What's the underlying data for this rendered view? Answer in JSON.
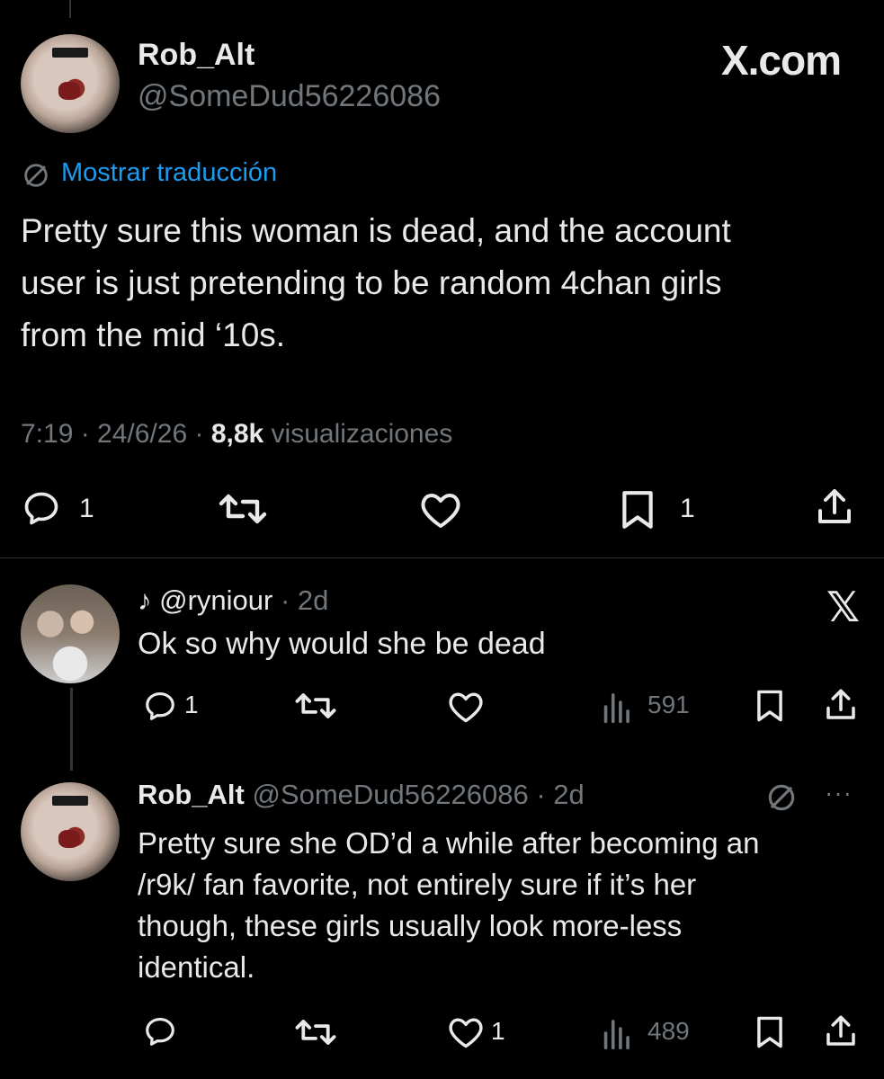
{
  "main_tweet": {
    "author_name": "Rob_Alt",
    "author_handle": "@SomeDud56226086",
    "watermark": "X.com",
    "translate_label": "Mostrar traducción",
    "text_lines": [
      "Pretty sure this woman is dead, and the account",
      "user is just pretending to be random 4chan girls",
      "from the mid ‘10s."
    ],
    "meta_time": "7:19 · 24/6/26 · ",
    "meta_views_count": "8,8k",
    "meta_views_label": " visualizaciones",
    "reply_count": "1",
    "bookmark_count": "1"
  },
  "reply_one": {
    "prefix": "♪ @ryniour",
    "time": "· 2d",
    "text": "Ok so why would she be dead",
    "reply_count": "1",
    "views": "591"
  },
  "reply_two": {
    "author_name": "Rob_Alt",
    "author_handle": "@SomeDud56226086",
    "time": "· 2d",
    "more": "···",
    "text_lines": [
      "Pretty sure she OD’d a while after becoming an",
      "/r9k/ fan favorite, not entirely sure if it’s her",
      "though, these girls usually look more-less",
      "identical."
    ],
    "like_count": "1",
    "views": "489"
  },
  "colors": {
    "background": "#000000",
    "text": "#e7e9ea",
    "secondary": "#71767b",
    "link": "#1d9bf0"
  }
}
